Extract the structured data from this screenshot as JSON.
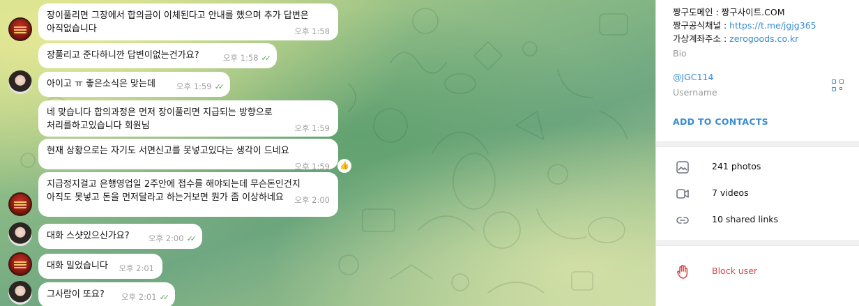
{
  "messages": [
    {
      "text": "장이풀리면 그장에서 합의금이 이체된다고 안내를 했으며 추가 답변은\n아직없습니다",
      "time": "오후 1:58"
    },
    {
      "text": "장풀리고 준다하니깐 답변이없는건가요?",
      "time": "오후 1:58"
    },
    {
      "text": "아이고 ㅠ 좋은소식은 맞는데",
      "time": "오후 1:59"
    },
    {
      "text": "네 맞습니다 합의과정은 먼저 장이풀리면 지급되는 방향으로\n처리를하고있습니다 회원님",
      "time": "오후 1:59"
    },
    {
      "text": "현재 상황으로는 자기도 서면신고를 못넣고있다는 생각이 드네요",
      "time": "오후 1:59"
    },
    {
      "text": "지급정지걸고 은행영업일 2주안에 접수를 해야되는데 무슨돈인건지\n아직도 못넣고 돈을 먼저달라고 하는거보면 뭔가 좀 이상하네요",
      "time": "오후 2:00"
    },
    {
      "text": "대화 스샷있으신가요?",
      "time": "오후 2:00"
    },
    {
      "text": "대화 밀었습니다",
      "time": "오후 2:01"
    },
    {
      "text": "그사람이 또요?",
      "time": "오후 2:01"
    }
  ],
  "reaction": "👍",
  "panel": {
    "domain_label": "짱구도메인 : ",
    "domain_value": "짱구사이트.COM",
    "channel_label": "짱구공식채널 : ",
    "channel_value": "https://t.me/jgjg365",
    "account_label": "가상계좌주소 : ",
    "account_value": "zerogoods.co.kr",
    "bio_caption": "Bio",
    "username": "@JGC114",
    "username_caption": "Username",
    "add_contacts": "ADD TO CONTACTS",
    "photos": "241 photos",
    "videos": "7 videos",
    "links": "10 shared links",
    "block": "Block user"
  },
  "colors": {
    "accent": "#3a8bd0",
    "outgoing_bubble": "#eefdde",
    "danger": "#d84646"
  }
}
